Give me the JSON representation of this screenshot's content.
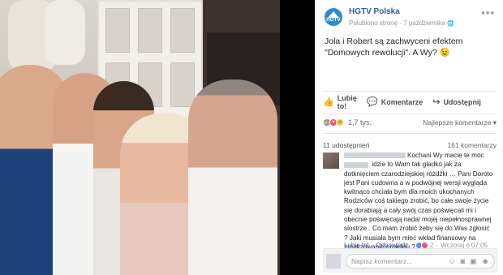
{
  "post": {
    "page_name": "HGTV Polska",
    "avatar_text": "HGTV",
    "meta_liked": "Polubiono stronę",
    "meta_sep": " · ",
    "meta_date": "7 października",
    "meta_globe": "🌐",
    "text": "Jola i Robert są zachwyceni efektem \"Domowych rewolucji\". A Wy? 😉"
  },
  "actions": {
    "like": "Lubię to!",
    "comment": "Komentarze",
    "share": "Udostępnij"
  },
  "reactions": {
    "count": "1,7 tys.",
    "sort_label": "Najlepsze komentarze ▾"
  },
  "stats": {
    "shares": "11 udostępnień",
    "comments": "161 komentarzy"
  },
  "comment": {
    "text_1": "Kochani Wy macie te",
    "text_2": "moc",
    "text_3": "idzie to Wam tak gładko jak za dotknięciem czarodziejskiej różdżki … Pani Doroto jest Pani cudowna a w podwójnej wersji wygląda kwitnąco chciała bym dla moich ukochanych Rodziców coś takiego zrobić, bo całe swoje życie się dorabiają a cały swój czas poświęcali mi i obecnie poświęcają nadal mojej niepełnosprawnej siostrze . Co mam zrobić żeby się do Was zgłosić ? Jaki musiała bym mieć wkład finansowy na zrealizowanie projektu ?",
    "like": "Lubię to!",
    "reply": "Odpowiedz",
    "reaction_count": "2",
    "time": "Wczoraj o 07:05"
  },
  "composer": {
    "placeholder": "Napisz komentarz..."
  },
  "colors": {
    "link": "#385898",
    "brand": "#2d8ccf",
    "like": "#5890ff",
    "love": "#f25268",
    "wow": "#f7c64a"
  }
}
